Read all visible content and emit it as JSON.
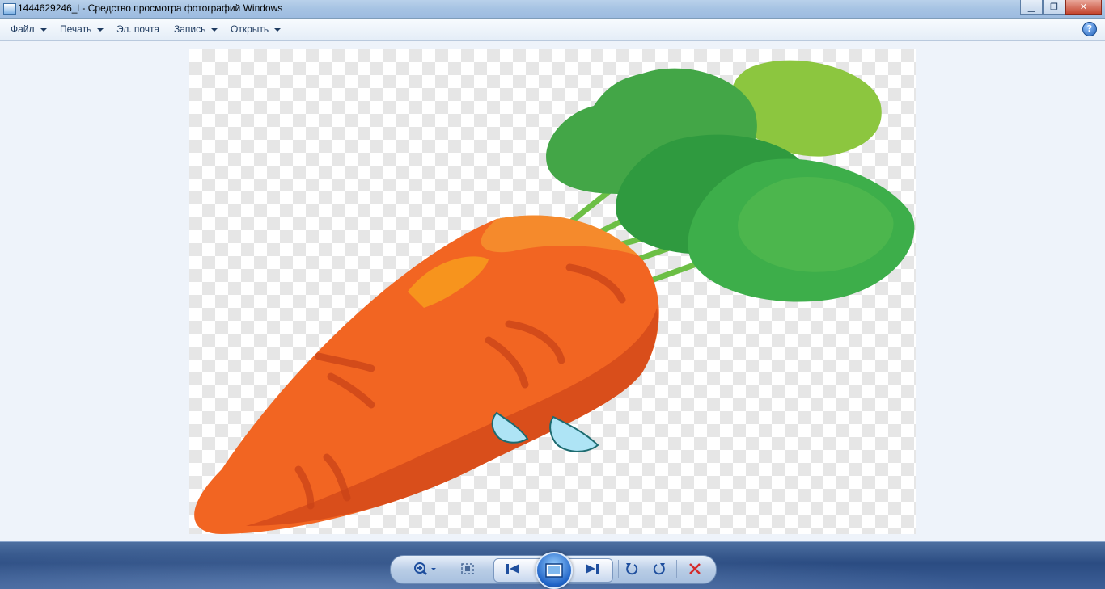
{
  "window": {
    "title": "1444629246_l - Средство просмотра фотографий Windows",
    "icon": "photo-viewer-icon",
    "controls": {
      "minimize": "▁",
      "maximize": "❐",
      "close": "✕"
    }
  },
  "menu": {
    "items": [
      {
        "label": "Файл",
        "has_dropdown": true
      },
      {
        "label": "Печать",
        "has_dropdown": true
      },
      {
        "label": "Эл. почта",
        "has_dropdown": false
      },
      {
        "label": "Запись",
        "has_dropdown": true
      },
      {
        "label": "Открыть",
        "has_dropdown": true
      }
    ],
    "help": "?"
  },
  "image": {
    "subject": "cartoon-carrot-with-teardrops",
    "colors": {
      "carrot": "#f26522",
      "carrot_dark": "#d94e1b",
      "leaves": "#3aa845",
      "leaves_light": "#8cc63f",
      "tear": "#aee4f5"
    }
  },
  "controls": [
    {
      "name": "zoom-icon"
    },
    {
      "name": "actual-size-icon"
    },
    {
      "name": "previous-icon"
    },
    {
      "name": "slideshow-icon"
    },
    {
      "name": "next-icon"
    },
    {
      "name": "rotate-left-icon"
    },
    {
      "name": "rotate-right-icon"
    },
    {
      "name": "delete-icon"
    }
  ],
  "theme": {
    "accent": "#2b4c82",
    "delete_red": "#d42a2a"
  }
}
